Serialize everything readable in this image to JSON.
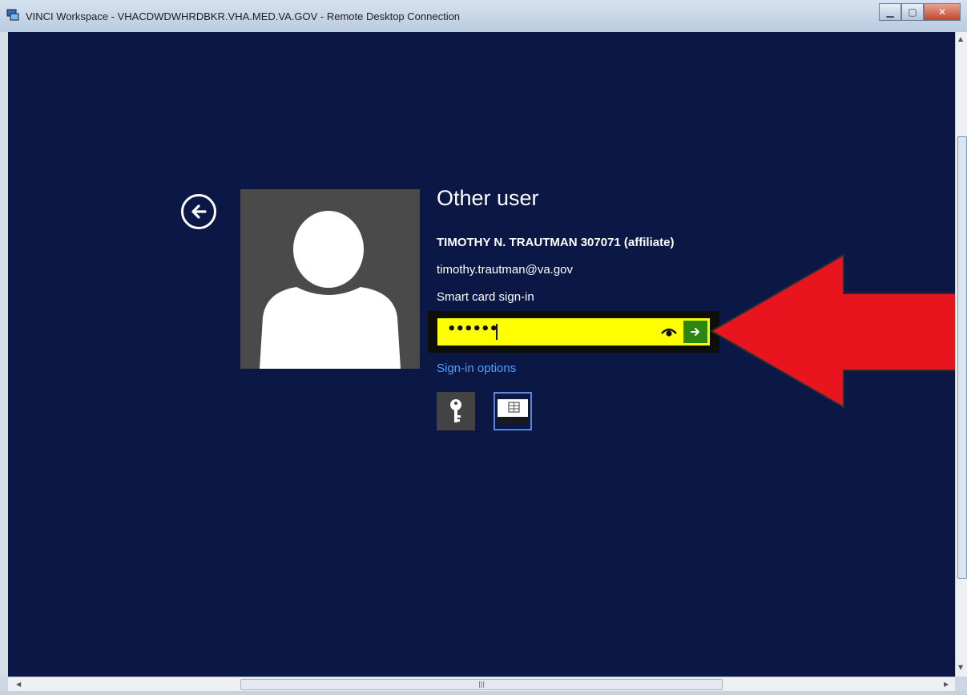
{
  "window": {
    "title": "VINCI Workspace - VHACDWDWHRDBKR.VHA.MED.VA.GOV - Remote Desktop Connection",
    "minimize_label": "▁",
    "maximize_label": "▢",
    "close_label": "✕",
    "app_icon": "remote-desktop-icon"
  },
  "login": {
    "heading": "Other user",
    "username": "TIMOTHY N. TRAUTMAN 307071 (affiliate)",
    "email": "timothy.trautman@va.gov",
    "signin_method": "Smart card sign-in",
    "pin_masked": "••••••",
    "sign_in_options_link": "Sign-in options",
    "icons": {
      "back": "back-arrow-icon",
      "avatar": "user-silhouette-icon",
      "reveal": "eye-icon",
      "submit": "arrow-right-icon",
      "option_key": "key-icon",
      "option_smartcard": "smart-card-icon"
    },
    "colors": {
      "background": "#0b1845",
      "pin_field": "#ffff00",
      "submit": "#2c8612",
      "link": "#4aa1ff",
      "annotation_arrow": "#e8141e"
    }
  },
  "scrollbar": {
    "h_grip": "|||"
  }
}
